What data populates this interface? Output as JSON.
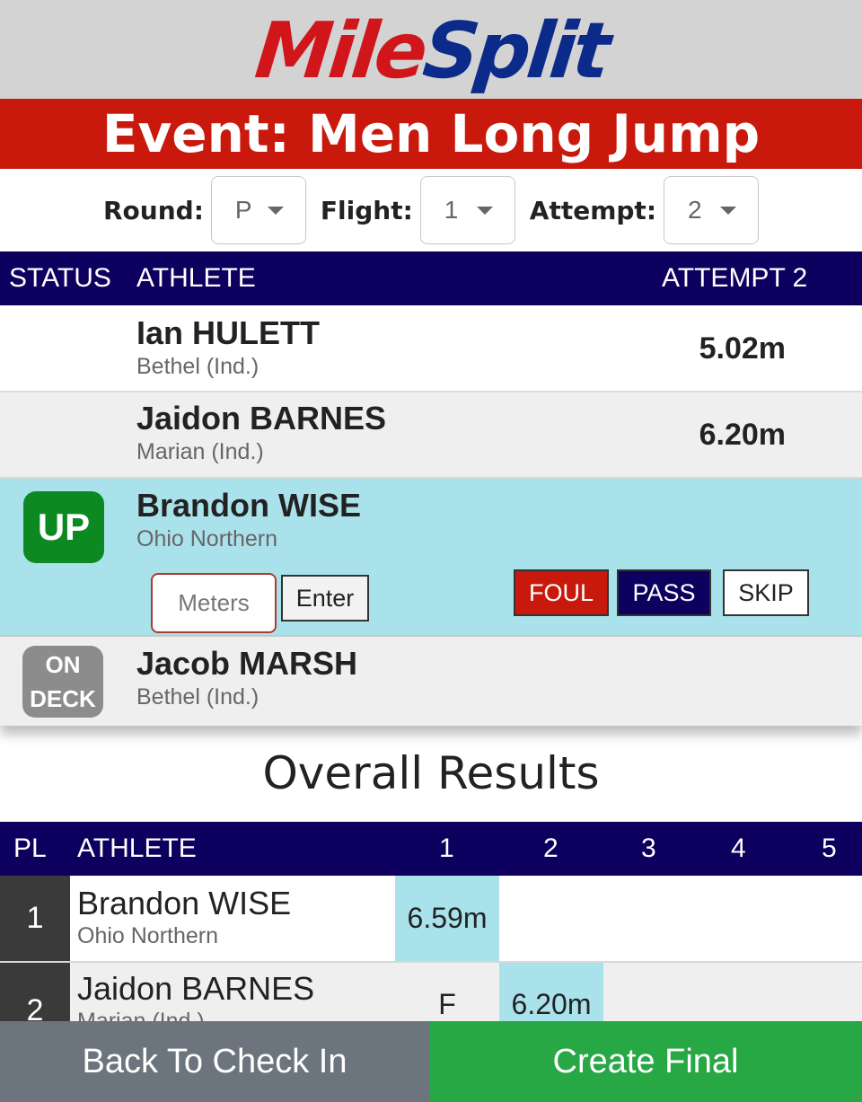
{
  "logo": {
    "part1": "Mile",
    "part2": "Split"
  },
  "event_title": "Event: Men Long Jump",
  "selectors": [
    {
      "label": "Round:",
      "value": "P"
    },
    {
      "label": "Flight:",
      "value": "1"
    },
    {
      "label": "Attempt:",
      "value": "2"
    }
  ],
  "attempt_table": {
    "headers": {
      "status": "STATUS",
      "athlete": "ATHLETE",
      "attempt": "ATTEMPT 2"
    },
    "rows": [
      {
        "name": "Ian HULETT",
        "team": "Bethel (Ind.)",
        "mark": "5.02m"
      },
      {
        "name": "Jaidon BARNES",
        "team": "Marian (Ind.)",
        "mark": "6.20m"
      },
      {
        "status": "UP",
        "name": "Brandon WISE",
        "team": "Ohio Northern"
      },
      {
        "status_line1": "ON",
        "status_line2": "DECK",
        "name": "Jacob MARSH",
        "team": "Bethel (Ind.)"
      }
    ],
    "entry": {
      "placeholder": "Meters",
      "enter_label": "Enter",
      "foul_label": "FOUL",
      "pass_label": "PASS",
      "skip_label": "SKIP"
    }
  },
  "overall": {
    "title": "Overall Results",
    "headers": {
      "pl": "PL",
      "athlete": "ATHLETE",
      "a1": "1",
      "a2": "2",
      "a3": "3",
      "a4": "4",
      "a5": "5"
    },
    "rows": [
      {
        "pl": "1",
        "name": "Brandon WISE",
        "team": "Ohio Northern",
        "a1": "6.59m",
        "a2": ""
      },
      {
        "pl": "2",
        "name": "Jaidon BARNES",
        "team": "Marian (Ind.)",
        "a1": "F",
        "a2": "6.20m"
      }
    ]
  },
  "footer": {
    "back_label": "Back To Check In",
    "create_label": "Create Final"
  },
  "colors": {
    "red": "#c8190c",
    "navy": "#0d005e",
    "up_green": "#0c8a21",
    "highlight": "#aae2ec",
    "create_green": "#28a745",
    "back_gray": "#6c757d"
  }
}
